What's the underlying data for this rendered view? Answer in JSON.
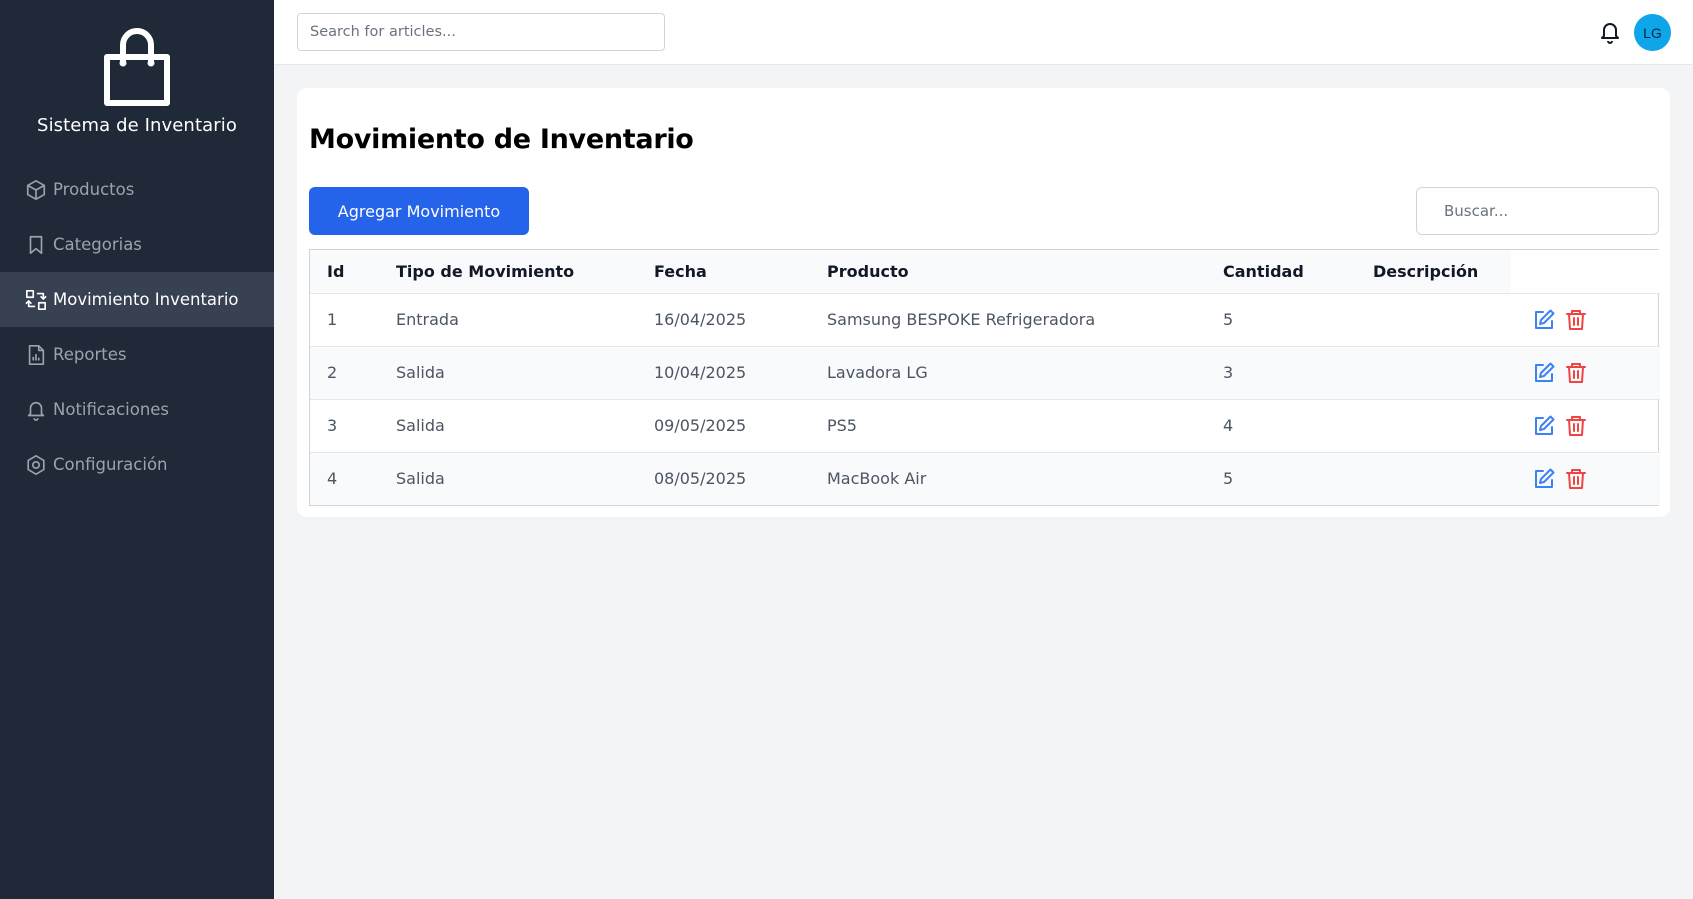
{
  "app": {
    "title": "Sistema de Inventario",
    "logo_icon": "shopping-bag-icon"
  },
  "sidebar": {
    "items": [
      {
        "label": "Productos",
        "icon": "cube-icon"
      },
      {
        "label": "Categorias",
        "icon": "bookmark-icon"
      },
      {
        "label": "Movimiento Inventario",
        "icon": "swap-icon",
        "active": true
      },
      {
        "label": "Reportes",
        "icon": "report-icon"
      },
      {
        "label": "Notificaciones",
        "icon": "bell-icon"
      },
      {
        "label": "Configuración",
        "icon": "gear-icon"
      }
    ]
  },
  "topbar": {
    "search_placeholder": "Search for articles...",
    "avatar_initials": "LG"
  },
  "main": {
    "title": "Movimiento de Inventario",
    "add_button": "Agregar Movimiento",
    "filter_placeholder": "Buscar...",
    "table": {
      "headers": [
        "Id",
        "Tipo de Movimiento",
        "Fecha",
        "Producto",
        "Cantidad",
        "Descripción"
      ],
      "rows": [
        {
          "id": "1",
          "tipo": "Entrada",
          "fecha": "16/04/2025",
          "producto": "Samsung BESPOKE Refrigeradora",
          "cantidad": "5",
          "descripcion": ""
        },
        {
          "id": "2",
          "tipo": "Salida",
          "fecha": "10/04/2025",
          "producto": "Lavadora LG",
          "cantidad": "3",
          "descripcion": ""
        },
        {
          "id": "3",
          "tipo": "Salida",
          "fecha": "09/05/2025",
          "producto": "PS5",
          "cantidad": "4",
          "descripcion": ""
        },
        {
          "id": "4",
          "tipo": "Salida",
          "fecha": "08/05/2025",
          "producto": "MacBook Air",
          "cantidad": "5",
          "descripcion": ""
        }
      ]
    }
  },
  "colors": {
    "sidebar_bg": "#1f2937",
    "sidebar_active": "#374151",
    "primary": "#2563eb",
    "edit": "#3b82f6",
    "delete": "#ef4444",
    "avatar": "#0ea5e9"
  }
}
